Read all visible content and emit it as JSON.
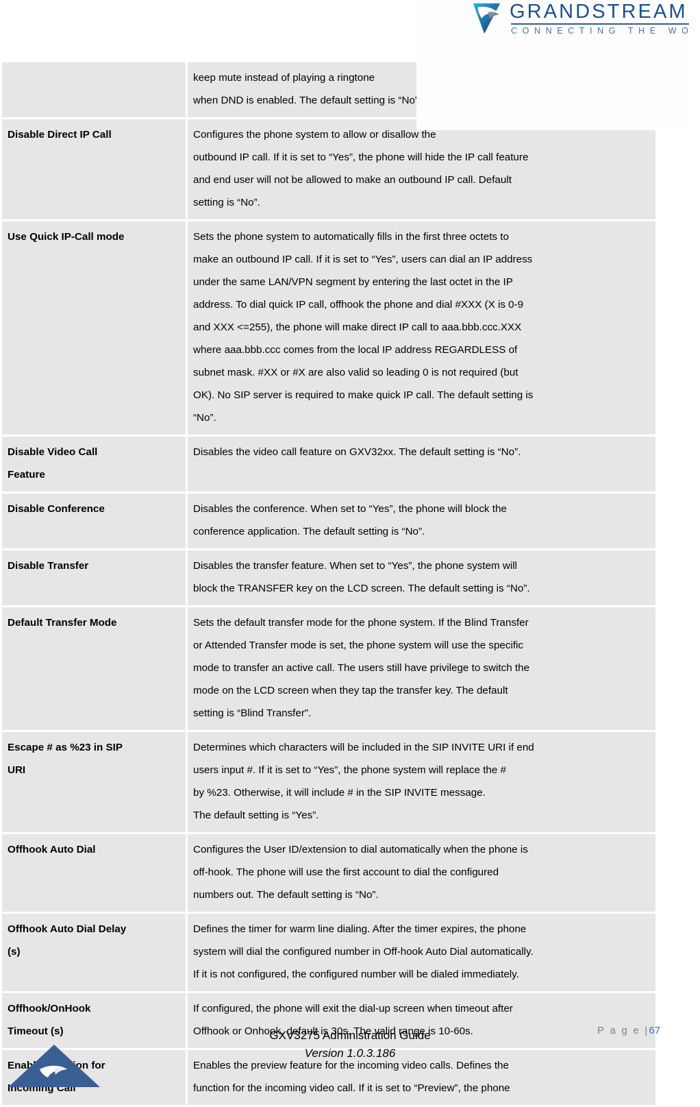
{
  "brand": {
    "logo_name": "grandstream-logo",
    "wordmark": "GRANDSTREAM",
    "tagline": "CONNECTING THE WORLD",
    "primary_color": "#1d4f8c",
    "accent_color": "#3a6eb5",
    "footer_logo_name": "grandstream-triangle-logo"
  },
  "table": {
    "rows": [
      {
        "label": "",
        "desc_lines": [
          "keep mute instead of playing a ringtone",
          "when DND is enabled. The default setting is “No”."
        ],
        "partial": true
      },
      {
        "label": "Disable Direct IP Call",
        "desc_lines": [
          "Configures the phone system to allow or disallow the",
          "outbound IP call. If it is set to “Yes”, the phone will hide the IP call feature",
          "and end user will not be allowed to make an outbound IP call. Default",
          "setting is “No”."
        ]
      },
      {
        "label": "Use Quick IP-Call mode",
        "desc_lines": [
          "Sets the phone system to automatically fills in the first three octets to",
          "make an outbound IP call. If it is set to “Yes”, users can dial an IP address",
          "under the same LAN/VPN segment by entering the last octet in the IP",
          "address. To dial quick IP call, offhook the phone and dial #XXX (X is 0-9",
          "and XXX <=255), the phone will make direct IP call to aaa.bbb.ccc.XXX",
          "where aaa.bbb.ccc comes from the local IP address REGARDLESS of",
          "subnet mask. #XX or #X are also valid so leading 0 is not required (but",
          "OK). No SIP server is required to make quick IP call. The default setting is",
          "“No”."
        ]
      },
      {
        "label": "Disable Video Call Feature",
        "label_lines": [
          "Disable Video Call",
          "Feature"
        ],
        "desc_lines": [
          "Disables the video call feature on GXV32xx. The default setting is “No”."
        ],
        "desc_centered": true
      },
      {
        "label": "Disable Conference",
        "desc_lines": [
          "Disables the conference. When set to “Yes”, the phone will block the",
          "conference application. The default setting is “No”."
        ]
      },
      {
        "label": "Disable Transfer",
        "desc_lines": [
          "Disables the transfer feature. When set to “Yes”, the phone system will",
          "block the TRANSFER key on the LCD screen. The default setting is “No”."
        ]
      },
      {
        "label": "Default Transfer Mode",
        "desc_lines": [
          "Sets the default transfer mode for the phone system. If the Blind Transfer",
          "or Attended Transfer mode is set, the phone system will use the specific",
          "mode to transfer an active call. The users still have privilege to switch the",
          "mode on the LCD screen when they tap the transfer key. The default",
          "setting is “Blind Transfer”."
        ]
      },
      {
        "label": "Escape # as %23 in SIP URI",
        "label_lines": [
          "Escape # as %23 in SIP",
          "URI"
        ],
        "desc_lines": [
          "Determines which characters will be included in the SIP INVITE URI if end",
          "users input #. If it is set to “Yes”, the phone system will replace the #",
          "by %23. Otherwise, it will include # in the SIP INVITE message.",
          "The default setting is “Yes”."
        ],
        "last_line_left": true
      },
      {
        "label": "Offhook Auto Dial",
        "desc_lines": [
          "Configures the User ID/extension to dial automatically when the phone is",
          "off-hook. The phone will use the first account to dial the configured",
          "numbers out. The default setting is “No”."
        ]
      },
      {
        "label": "Offhook Auto Dial Delay (s)",
        "label_lines": [
          "Offhook Auto Dial Delay",
          "(s)"
        ],
        "desc_lines": [
          "Defines the timer for warm line dialing. After the timer expires, the phone",
          "system will dial the configured number in Off-hook Auto Dial automatically.",
          "If it is not configured, the configured number will be dialed immediately."
        ],
        "left_aligned": true
      },
      {
        "label": "Offhook/OnHook Timeout (s)",
        "label_lines": [
          "Offhook/OnHook",
          "Timeout (s)"
        ],
        "desc_lines": [
          "If configured, the phone will exit the dial-up screen when timeout after",
          "Offhook or Onhook. default is 30s. The valid range is 10-60s."
        ]
      },
      {
        "label": "Enable Function for Incoming Call",
        "label_lines": [
          "Enable Function for",
          "Incoming Call"
        ],
        "desc_lines": [
          "Enables the preview feature for the incoming video calls. Defines the",
          "function for the incoming video call. If it is set to “Preview”, the phone"
        ],
        "partial_bottom": true
      }
    ]
  },
  "footer": {
    "page_label": "P a g e  |",
    "page_number": "67",
    "doc_title": "GXV3275 Administration Guide",
    "doc_version": "Version 1.0.3.186"
  }
}
